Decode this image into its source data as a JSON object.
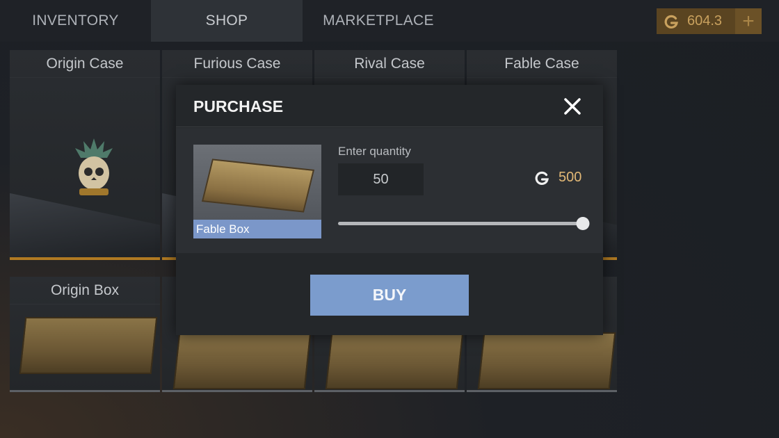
{
  "nav": {
    "tabs": [
      {
        "label": "INVENTORY",
        "active": false
      },
      {
        "label": "SHOP",
        "active": true
      },
      {
        "label": "MARKETPLACE",
        "active": false
      }
    ]
  },
  "currency": {
    "icon": "g-coin-icon",
    "value": "604.3",
    "add_label": "+",
    "color": "#c9a15e"
  },
  "shop": {
    "cases": [
      "Origin Case",
      "Furious Case",
      "Rival Case",
      "Fable Case"
    ],
    "boxes": [
      "Origin Box"
    ]
  },
  "modal": {
    "title": "PURCHASE",
    "close_icon": "close-icon",
    "item_name": "Fable Box",
    "quantity_label": "Enter quantity",
    "quantity_value": "50",
    "price_icon": "g-coin-icon",
    "price_value": "500",
    "slider_fraction": 1.0,
    "buy_label": "BUY",
    "accent_color": "#7b9ccd"
  }
}
